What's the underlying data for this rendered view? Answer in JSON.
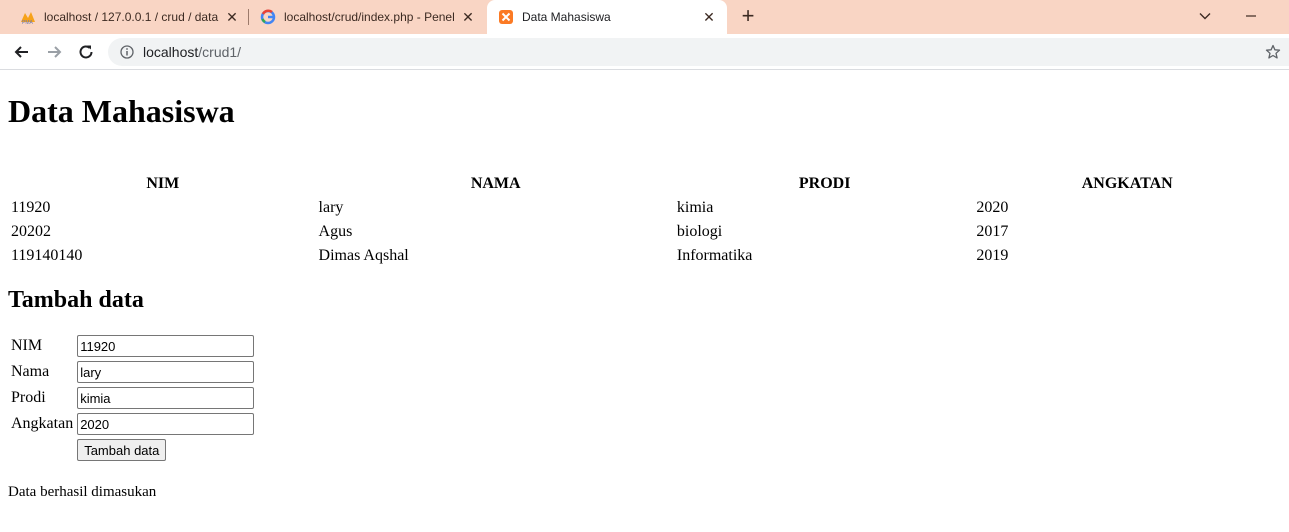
{
  "browser": {
    "tabs": [
      {
        "title": "localhost / 127.0.0.1 / crud / data",
        "favicon": "phpmyadmin-icon",
        "active": false
      },
      {
        "title": "localhost/crud/index.php - Penel",
        "favicon": "google-icon",
        "active": false
      },
      {
        "title": "Data Mahasiswa",
        "favicon": "xampp-icon",
        "active": true
      }
    ],
    "address": {
      "host": "localhost",
      "path": "/crud1/"
    }
  },
  "page": {
    "title": "Data Mahasiswa",
    "table": {
      "headers": [
        "NIM",
        "NAMA",
        "PRODI",
        "ANGKATAN"
      ],
      "rows": [
        [
          "11920",
          "lary",
          "kimia",
          "2020"
        ],
        [
          "20202",
          "Agus",
          "biologi",
          "2017"
        ],
        [
          "119140140",
          "Dimas Aqshal",
          "Informatika",
          "2019"
        ]
      ]
    },
    "form": {
      "title": "Tambah data",
      "fields": [
        {
          "label": "NIM",
          "value": "11920"
        },
        {
          "label": "Nama",
          "value": "lary"
        },
        {
          "label": "Prodi",
          "value": "kimia"
        },
        {
          "label": "Angkatan",
          "value": "2020"
        }
      ],
      "submit_label": "Tambah data"
    },
    "status_message": "Data berhasil dimasukan"
  }
}
